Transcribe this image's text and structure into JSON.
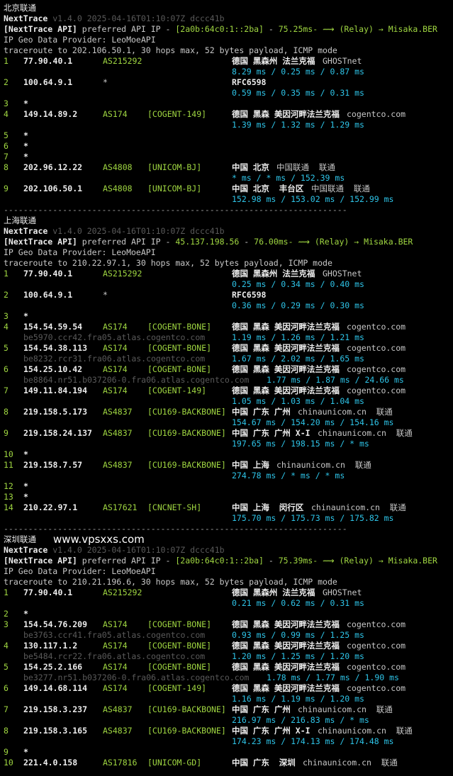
{
  "colors": {
    "background": "#000000",
    "text": "#c8c8c8",
    "white": "#ececec",
    "green": "#9fd641",
    "cyan": "#2ec4e8",
    "gray": "#8a8a8a",
    "dim": "#5a5a5a"
  },
  "watermark": "www.vpsxxs.com",
  "separator": "----------------------------------------------------------------------",
  "sections": [
    {
      "label": "北京联通",
      "version": "NextTrace v1.4.0 2025-04-16T01:10:07Z dccc41b",
      "api_prefix": "[NextTrace API]",
      "api_text": " preferred API IP - ",
      "api_ip": "[2a0b:64c0:1::2ba]",
      "api_sep": " - ",
      "api_latency": "75.25ms",
      "api_relay": "- ⟿ (Relay) → Misaka.BER",
      "geo": "IP Geo Data Provider: LeoMoeAPI",
      "trace": "traceroute to 202.106.50.1, 30 hops max, 52 bytes payload, ICMP mode",
      "hops": [
        {
          "n": "1",
          "ip": "77.90.40.1",
          "asn": "AS215292",
          "tag": "",
          "geo": "德国 黑森州 法兰克福",
          "org": "GHOSTnet",
          "rdns": "",
          "rtt": "8.29 ms / 0.25 ms / 0.87 ms"
        },
        {
          "n": "2",
          "ip": "100.64.9.1",
          "asn": "*",
          "tag": "",
          "geo": "RFC6598",
          "org": "",
          "rdns": "",
          "rtt": "0.59 ms / 0.35 ms / 0.31 ms"
        },
        {
          "n": "3",
          "ip": "*",
          "asn": "",
          "tag": "",
          "geo": "",
          "org": "",
          "rdns": "",
          "rtt": ""
        },
        {
          "n": "4",
          "ip": "149.14.89.2",
          "asn": "AS174",
          "tag": "[COGENT-149]",
          "geo": "德国 黑森 美因河畔法兰克福",
          "org": "cogentco.com",
          "rdns": "",
          "rtt": "1.39 ms / 1.32 ms / 1.29 ms"
        },
        {
          "n": "5",
          "ip": "*",
          "asn": "",
          "tag": "",
          "geo": "",
          "org": "",
          "rdns": "",
          "rtt": ""
        },
        {
          "n": "6",
          "ip": "*",
          "asn": "",
          "tag": "",
          "geo": "",
          "org": "",
          "rdns": "",
          "rtt": ""
        },
        {
          "n": "7",
          "ip": "*",
          "asn": "",
          "tag": "",
          "geo": "",
          "org": "",
          "rdns": "",
          "rtt": ""
        },
        {
          "n": "8",
          "ip": "202.96.12.22",
          "asn": "AS4808",
          "tag": "[UNICOM-BJ]",
          "geo": "中国 北京",
          "org": "中国联通  联通",
          "rdns": "",
          "rtt": "* ms / * ms / 152.39 ms"
        },
        {
          "n": "9",
          "ip": "202.106.50.1",
          "asn": "AS4808",
          "tag": "[UNICOM-BJ]",
          "geo": "中国 北京  丰台区",
          "org": "中国联通  联通",
          "rdns": "",
          "rtt": "152.98 ms / 153.02 ms / 152.99 ms"
        }
      ]
    },
    {
      "label": "上海联通",
      "version": "NextTrace v1.4.0 2025-04-16T01:10:07Z dccc41b",
      "api_prefix": "[NextTrace API]",
      "api_text": " preferred API IP - ",
      "api_ip": "45.137.198.56",
      "api_sep": " - ",
      "api_latency": "76.00ms",
      "api_relay": "- ⟿ (Relay) → Misaka.BER",
      "geo": "IP Geo Data Provider: LeoMoeAPI",
      "trace": "traceroute to 210.22.97.1, 30 hops max, 52 bytes payload, ICMP mode",
      "hops": [
        {
          "n": "1",
          "ip": "77.90.40.1",
          "asn": "AS215292",
          "tag": "",
          "geo": "德国 黑森州 法兰克福",
          "org": "GHOSTnet",
          "rdns": "",
          "rtt": "0.25 ms / 0.34 ms / 0.40 ms"
        },
        {
          "n": "2",
          "ip": "100.64.9.1",
          "asn": "*",
          "tag": "",
          "geo": "RFC6598",
          "org": "",
          "rdns": "",
          "rtt": "0.36 ms / 0.29 ms / 0.30 ms"
        },
        {
          "n": "3",
          "ip": "*",
          "asn": "",
          "tag": "",
          "geo": "",
          "org": "",
          "rdns": "",
          "rtt": ""
        },
        {
          "n": "4",
          "ip": "154.54.59.54",
          "asn": "AS174",
          "tag": "[COGENT-BONE]",
          "geo": "德国 黑森 美因河畔法兰克福",
          "org": "cogentco.com",
          "rdns": "be5970.ccr42.fra05.atlas.cogentco.com",
          "rtt": "1.19 ms / 1.26 ms / 1.21 ms"
        },
        {
          "n": "5",
          "ip": "154.54.38.113",
          "asn": "AS174",
          "tag": "[COGENT-BONE]",
          "geo": "德国 黑森 美因河畔法兰克福",
          "org": "cogentco.com",
          "rdns": "be8232.rcr31.fra06.atlas.cogentco.com",
          "rtt": "1.67 ms / 2.02 ms / 1.65 ms"
        },
        {
          "n": "6",
          "ip": "154.25.10.42",
          "asn": "AS174",
          "tag": "[COGENT-BONE]",
          "geo": "德国 黑森 美因河畔法兰克福",
          "org": "cogentco.com",
          "rdns": "be8864.nr51.b037206-0.fra06.atlas.cogentco.com",
          "rtt": "1.77 ms / 1.87 ms / 24.66 ms"
        },
        {
          "n": "7",
          "ip": "149.11.84.194",
          "asn": "AS174",
          "tag": "[COGENT-149]",
          "geo": "德国 黑森 美因河畔法兰克福",
          "org": "cogentco.com",
          "rdns": "",
          "rtt": "1.05 ms / 1.03 ms / 1.04 ms"
        },
        {
          "n": "8",
          "ip": "219.158.5.173",
          "asn": "AS4837",
          "tag": "[CU169-BACKBONE]",
          "geo": "中国 广东 广州",
          "org": "chinaunicom.cn  联通",
          "rdns": "",
          "rtt": "154.67 ms / 154.20 ms / 154.16 ms"
        },
        {
          "n": "9",
          "ip": "219.158.24.137",
          "asn": "AS4837",
          "tag": "[CU169-BACKBONE]",
          "geo": "中国 广东 广州 X-I",
          "org": "chinaunicom.cn  联通",
          "rdns": "",
          "rtt": "197.65 ms / 198.15 ms / * ms"
        },
        {
          "n": "10",
          "ip": "*",
          "asn": "",
          "tag": "",
          "geo": "",
          "org": "",
          "rdns": "",
          "rtt": ""
        },
        {
          "n": "11",
          "ip": "219.158.7.57",
          "asn": "AS4837",
          "tag": "[CU169-BACKBONE]",
          "geo": "中国 上海",
          "org": "chinaunicom.cn  联通",
          "rdns": "",
          "rtt": "274.78 ms / * ms / * ms"
        },
        {
          "n": "12",
          "ip": "*",
          "asn": "",
          "tag": "",
          "geo": "",
          "org": "",
          "rdns": "",
          "rtt": ""
        },
        {
          "n": "13",
          "ip": "*",
          "asn": "",
          "tag": "",
          "geo": "",
          "org": "",
          "rdns": "",
          "rtt": ""
        },
        {
          "n": "14",
          "ip": "210.22.97.1",
          "asn": "AS17621",
          "tag": "[CNCNET-SH]",
          "geo": "中国 上海  闵行区",
          "org": "chinaunicom.cn  联通",
          "rdns": "",
          "rtt": "175.70 ms / 175.73 ms / 175.82 ms"
        }
      ]
    },
    {
      "label": "深圳联通",
      "version": "NextTrace v1.4.0 2025-04-16T01:10:07Z dccc41b",
      "api_prefix": "[NextTrace API]",
      "api_text": " preferred API IP - ",
      "api_ip": "[2a0b:64c0:1::2ba]",
      "api_sep": " - ",
      "api_latency": "75.39ms",
      "api_relay": "- ⟿ (Relay) → Misaka.BER",
      "geo": "IP Geo Data Provider: LeoMoeAPI",
      "trace": "traceroute to 210.21.196.6, 30 hops max, 52 bytes payload, ICMP mode",
      "hops": [
        {
          "n": "1",
          "ip": "77.90.40.1",
          "asn": "AS215292",
          "tag": "",
          "geo": "德国 黑森州 法兰克福",
          "org": "GHOSTnet",
          "rdns": "",
          "rtt": "0.21 ms / 0.62 ms / 0.31 ms"
        },
        {
          "n": "2",
          "ip": "*",
          "asn": "",
          "tag": "",
          "geo": "",
          "org": "",
          "rdns": "",
          "rtt": ""
        },
        {
          "n": "3",
          "ip": "154.54.76.209",
          "asn": "AS174",
          "tag": "[COGENT-BONE]",
          "geo": "德国 黑森 美因河畔法兰克福",
          "org": "cogentco.com",
          "rdns": "be3763.ccr41.fra05.atlas.cogentco.com",
          "rtt": "0.93 ms / 0.99 ms / 1.25 ms"
        },
        {
          "n": "4",
          "ip": "130.117.1.2",
          "asn": "AS174",
          "tag": "[COGENT-BONE]",
          "geo": "德国 黑森 美因河畔法兰克福",
          "org": "cogentco.com",
          "rdns": "be5484.rcr22.fra06.atlas.cogentco.com",
          "rtt": "1.20 ms / 1.25 ms / 1.20 ms"
        },
        {
          "n": "5",
          "ip": "154.25.2.166",
          "asn": "AS174",
          "tag": "[COGENT-BONE]",
          "geo": "德国 黑森 美因河畔法兰克福",
          "org": "cogentco.com",
          "rdns": "be3277.nr51.b037206-0.fra06.atlas.cogentco.com",
          "rtt": "1.78 ms / 1.77 ms / 1.90 ms"
        },
        {
          "n": "6",
          "ip": "149.14.68.114",
          "asn": "AS174",
          "tag": "[COGENT-149]",
          "geo": "德国 黑森 美因河畔法兰克福",
          "org": "cogentco.com",
          "rdns": "",
          "rtt": "1.16 ms / 1.19 ms / 1.20 ms"
        },
        {
          "n": "7",
          "ip": "219.158.3.237",
          "asn": "AS4837",
          "tag": "[CU169-BACKBONE]",
          "geo": "中国 广东 广州",
          "org": "chinaunicom.cn  联通",
          "rdns": "",
          "rtt": "216.97 ms / 216.83 ms / * ms"
        },
        {
          "n": "8",
          "ip": "219.158.3.165",
          "asn": "AS4837",
          "tag": "[CU169-BACKBONE]",
          "geo": "中国 广东 广州 X-I",
          "org": "chinaunicom.cn  联通",
          "rdns": "",
          "rtt": "174.23 ms / 174.13 ms / 174.48 ms"
        },
        {
          "n": "9",
          "ip": "*",
          "asn": "",
          "tag": "",
          "geo": "",
          "org": "",
          "rdns": "",
          "rtt": ""
        },
        {
          "n": "10",
          "ip": "221.4.0.158",
          "asn": "AS17816",
          "tag": "[UNICOM-GD]",
          "geo": "中国 广东  深圳",
          "org": "chinaunicom.cn  联通",
          "rdns": "",
          "rtt": ""
        }
      ]
    }
  ]
}
